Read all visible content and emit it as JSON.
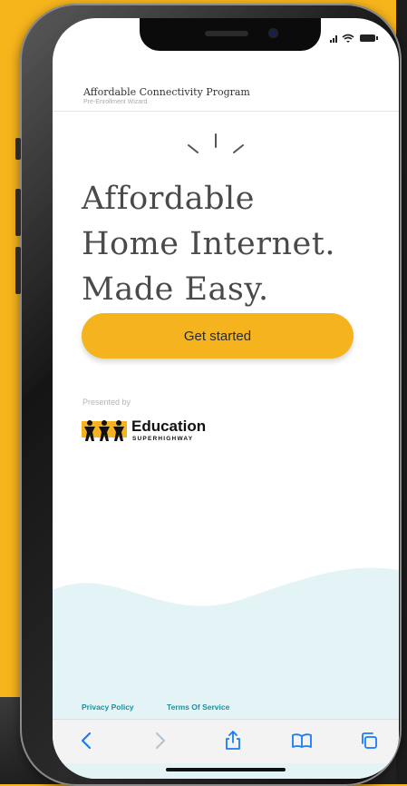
{
  "statusbar": {
    "icons": "signal wifi battery"
  },
  "site": {
    "title": "Affordable Connectivity Program",
    "subtitle": "Pre-Enrollment Wizard"
  },
  "hero": {
    "line1": "Affordable",
    "line2": "Home Internet.",
    "line3": "Made Easy."
  },
  "cta": {
    "label": "Get started"
  },
  "presented": {
    "label": "Presented by",
    "logo_word": "Education",
    "logo_sub": "SUPERHIGHWAY"
  },
  "footer": {
    "privacy": "Privacy Policy",
    "terms": "Terms Of Service"
  },
  "toolbar": {
    "icons": [
      "back-icon",
      "forward-icon",
      "share-icon",
      "bookmarks-icon",
      "tabs-icon"
    ]
  },
  "colors": {
    "background": "#f7b51c",
    "accent": "#f5b41d",
    "link": "#1f8f9a",
    "wave": "#e4f3f5",
    "ios_blue": "#1a7cf5"
  }
}
